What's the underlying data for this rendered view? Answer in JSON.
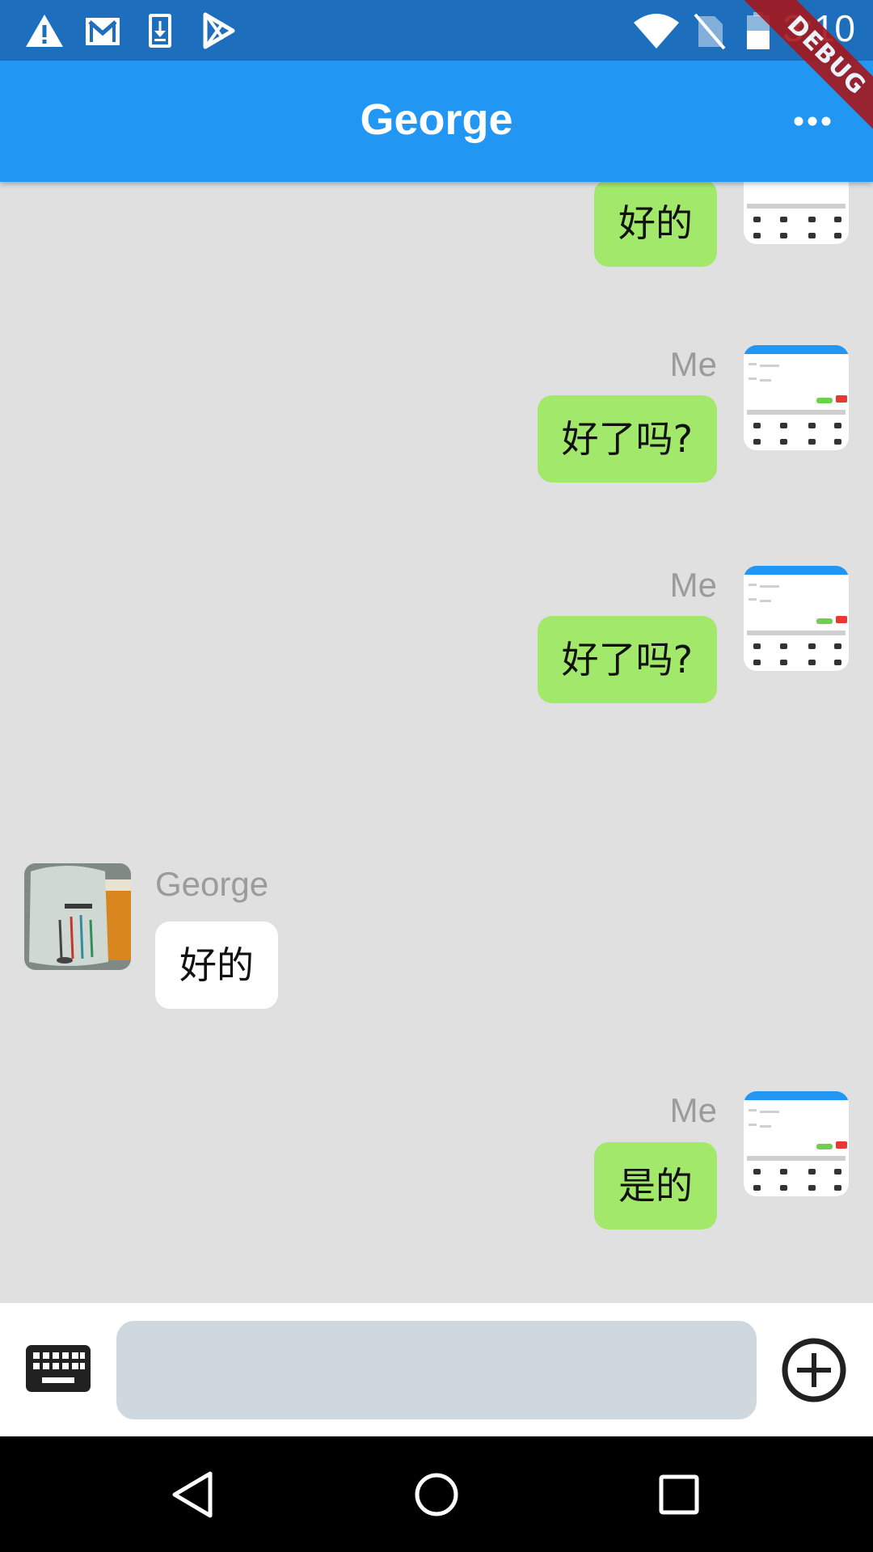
{
  "status_bar": {
    "time": "3:10",
    "left_icons": [
      "warning-icon",
      "gmail-icon",
      "download-icon",
      "play-store-icon"
    ],
    "right_icons": [
      "wifi-icon",
      "no-sim-icon",
      "battery-icon"
    ]
  },
  "debug_banner": "DEBUG",
  "app_bar": {
    "title": "George",
    "menu_icon": "more-horizontal-icon"
  },
  "messages": [
    {
      "from": "me",
      "sender": "",
      "text": "好的"
    },
    {
      "from": "me",
      "sender": "Me",
      "text": "好了吗?"
    },
    {
      "from": "me",
      "sender": "Me",
      "text": "好了吗?"
    },
    {
      "from": "other",
      "sender": "George",
      "text": "好的"
    },
    {
      "from": "me",
      "sender": "Me",
      "text": "是的"
    }
  ],
  "input_bar": {
    "left_icon": "keyboard-icon",
    "input_value": "",
    "right_icon": "add-circle-icon"
  },
  "nav_bar": {
    "buttons": [
      "back-icon",
      "home-icon",
      "recents-icon"
    ]
  },
  "colors": {
    "status_bar": "#1d6fbd",
    "app_bar": "#2196f3",
    "chat_background": "#e0e0e0",
    "my_bubble": "#a2e86b",
    "their_bubble": "#ffffff",
    "input_field": "#d0d8df",
    "debug_ribbon": "#a5171c"
  }
}
